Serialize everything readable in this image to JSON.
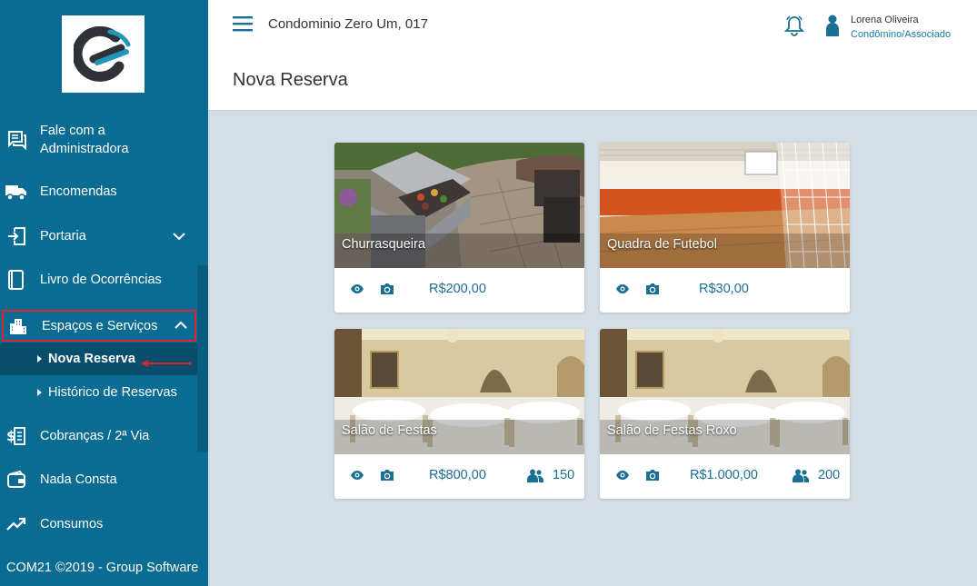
{
  "sidebar": {
    "items": [
      {
        "label_line1": "Fale com a",
        "label_line2": "Administradora",
        "icon": "chat-icon"
      },
      {
        "label": "Encomendas",
        "icon": "truck-icon"
      },
      {
        "label": "Portaria",
        "icon": "door-enter-icon"
      },
      {
        "label": "Livro de Ocorrências",
        "icon": "book-icon"
      },
      {
        "label": "Espaços e Serviços",
        "icon": "building-icon"
      },
      {
        "label": "Cobranças / 2ª Via",
        "icon": "invoice-icon"
      },
      {
        "label": "Nada Consta",
        "icon": "wallet-icon"
      },
      {
        "label": "Consumos",
        "icon": "trending-up-icon"
      }
    ],
    "subitems": [
      {
        "label": "Nova Reserva"
      },
      {
        "label": "Histórico de Reservas"
      }
    ],
    "footer": "COM21 ©2019 - Group Software"
  },
  "header": {
    "condo": "Condominio Zero Um, 017",
    "user_name": "Lorena Oliveira",
    "user_role": "Condômino/Associado",
    "page_title": "Nova Reserva"
  },
  "cards": [
    {
      "name": "Churrasqueira",
      "price": "R$200,00",
      "capacity": ""
    },
    {
      "name": "Quadra de Futebol",
      "price": "R$30,00",
      "capacity": ""
    },
    {
      "name": "Salão de Festas",
      "price": "R$800,00",
      "capacity": "150"
    },
    {
      "name": "Salão de Festas Roxo",
      "price": "R$1.000,00",
      "capacity": "200"
    }
  ],
  "colors": {
    "sidebar": "#0a6b93",
    "sidebar_selected": "#084e6c",
    "accent": "#1a6f94",
    "highlight": "#e0232c",
    "content_bg": "#d4dee6"
  }
}
